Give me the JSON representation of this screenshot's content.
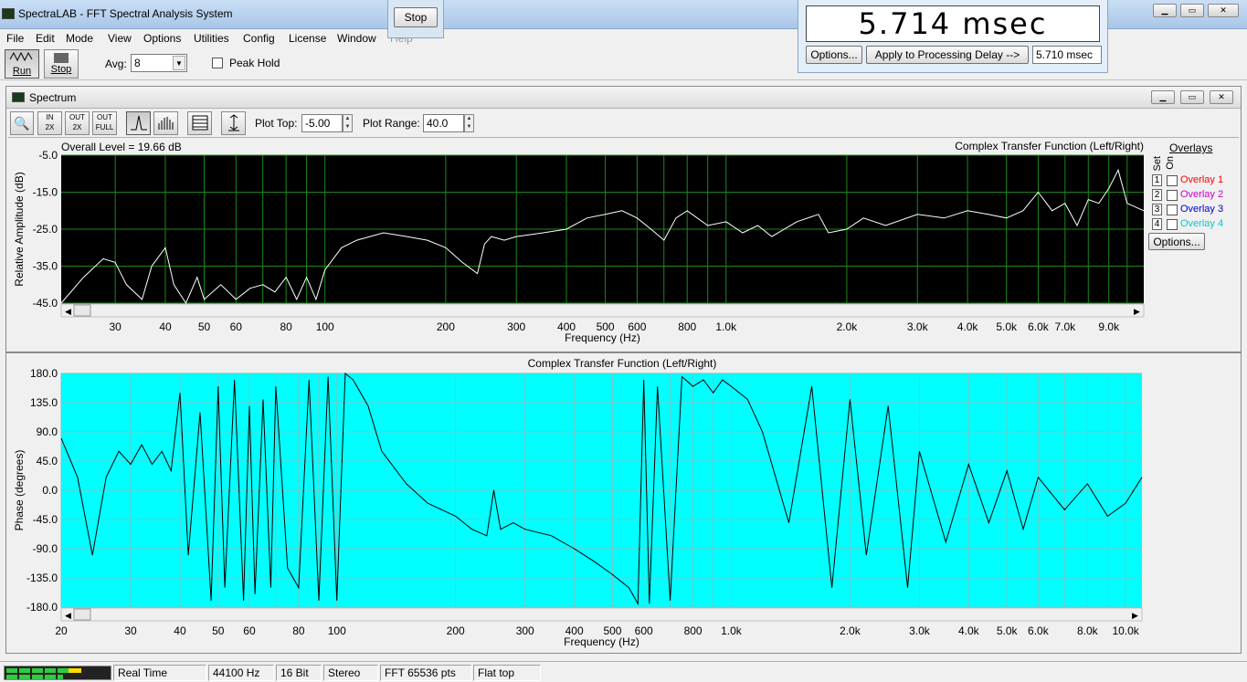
{
  "window": {
    "title": "SpectraLAB - FFT Spectral Analysis System"
  },
  "menu": [
    "File",
    "Edit",
    "Mode",
    "View",
    "Options",
    "Utilities",
    "Config",
    "License",
    "Window",
    "Help"
  ],
  "toolbar": {
    "run_label": "Run",
    "stop_label": "Stop",
    "avg_label": "Avg:",
    "avg_value": "8",
    "peak_hold_label": "Peak Hold"
  },
  "floating_stop": {
    "label": "Stop"
  },
  "delay_panel": {
    "value": "5.714  msec",
    "options_label": "Options...",
    "apply_label": "Apply to Processing Delay -->",
    "delay_field": "5.710 msec"
  },
  "spectrum": {
    "title": "Spectrum",
    "plot_top_label": "Plot Top:",
    "plot_top_value": "-5.00",
    "plot_range_label": "Plot Range:",
    "plot_range_value": "40.0",
    "overall_level": "Overall Level = 19.66 dB",
    "chart_title": "Complex Transfer Function (Left/Right)",
    "ylabel": "Relative Amplitude (dB)",
    "xlabel": "Frequency (Hz)",
    "y_ticks": [
      "-5.0",
      "-15.0",
      "-25.0",
      "-35.0",
      "-45.0"
    ],
    "x_ticks": [
      "30",
      "40",
      "50",
      "60",
      "80",
      "100",
      "200",
      "300",
      "400",
      "500",
      "600",
      "800",
      "1.0k",
      "2.0k",
      "3.0k",
      "4.0k",
      "5.0k",
      "6.0k",
      "7.0k",
      "9.0k"
    ],
    "overlays_label": "Overlays",
    "set_label": "Set",
    "on_label": "On",
    "overlays": [
      {
        "num": "1",
        "label": "Overlay 1",
        "color": "#ff0000"
      },
      {
        "num": "2",
        "label": "Overlay 2",
        "color": "#cc00cc"
      },
      {
        "num": "3",
        "label": "Overlay 3",
        "color": "#0000cc"
      },
      {
        "num": "4",
        "label": "Overlay 4",
        "color": "#00cccc"
      }
    ],
    "options_label": "Options..."
  },
  "phase": {
    "chart_title": "Complex Transfer Function (Left/Right)",
    "ylabel": "Phase (degrees)",
    "xlabel": "Frequency (Hz)",
    "y_ticks": [
      "180.0",
      "135.0",
      "90.0",
      "45.0",
      "0.0",
      "-45.0",
      "-90.0",
      "-135.0",
      "-180.0"
    ],
    "x_ticks": [
      "20",
      "30",
      "40",
      "50",
      "60",
      "80",
      "100",
      "200",
      "300",
      "400",
      "500",
      "600",
      "800",
      "1.0k",
      "2.0k",
      "3.0k",
      "4.0k",
      "5.0k",
      "6.0k",
      "8.0k",
      "10.0k"
    ]
  },
  "status": {
    "mode": "Real Time",
    "rate": "44100 Hz",
    "bits": "16 Bit",
    "channels": "Stereo",
    "fft": "FFT 65536 pts",
    "window": "Flat top"
  },
  "chart_data": [
    {
      "type": "line",
      "title": "Complex Transfer Function (Left/Right)",
      "xlabel": "Frequency (Hz)",
      "ylabel": "Relative Amplitude (dB)",
      "xscale": "log",
      "xlim": [
        22,
        11000
      ],
      "ylim": [
        -45,
        -5
      ],
      "grid": true,
      "series": [
        {
          "x": [
            22,
            25,
            28,
            30,
            32,
            35,
            37,
            40,
            42,
            45,
            48,
            50,
            55,
            60,
            65,
            70,
            75,
            80,
            85,
            90,
            95,
            100,
            110,
            120,
            140,
            160,
            180,
            200,
            220,
            240,
            250,
            260,
            280,
            300,
            350,
            400,
            450,
            500,
            550,
            600,
            650,
            700,
            750,
            800,
            900,
            1000,
            1100,
            1200,
            1300,
            1500,
            1700,
            1800,
            2000,
            2200,
            2500,
            3000,
            3500,
            4000,
            4500,
            5000,
            5500,
            6000,
            6500,
            7000,
            7500,
            8000,
            8500,
            9000,
            9500,
            10000,
            11000
          ],
          "y": [
            -45,
            -38,
            -33,
            -34,
            -40,
            -44,
            -35,
            -30,
            -40,
            -45,
            -38,
            -44,
            -40,
            -44,
            -41,
            -40,
            -42,
            -38,
            -44,
            -38,
            -44,
            -36,
            -30,
            -28,
            -26,
            -27,
            -28,
            -30,
            -34,
            -37,
            -29,
            -27,
            -28,
            -27,
            -26,
            -25,
            -22,
            -21,
            -20,
            -22,
            -25,
            -28,
            -22,
            -20,
            -24,
            -23,
            -26,
            -24,
            -27,
            -23,
            -21,
            -26,
            -25,
            -22,
            -24,
            -21,
            -22,
            -20,
            -21,
            -22,
            -20,
            -15,
            -20,
            -18,
            -24,
            -17,
            -18,
            -14,
            -9,
            -18,
            -20
          ]
        }
      ]
    },
    {
      "type": "line",
      "title": "Complex Transfer Function (Left/Right)",
      "xlabel": "Frequency (Hz)",
      "ylabel": "Phase (degrees)",
      "xscale": "log",
      "xlim": [
        20,
        11000
      ],
      "ylim": [
        -180,
        180
      ],
      "grid": true,
      "series": [
        {
          "x": [
            20,
            22,
            24,
            26,
            28,
            30,
            32,
            34,
            36,
            38,
            40,
            42,
            45,
            48,
            50,
            52,
            55,
            58,
            60,
            62,
            65,
            68,
            70,
            75,
            80,
            85,
            90,
            95,
            100,
            105,
            110,
            120,
            130,
            150,
            170,
            200,
            220,
            240,
            250,
            260,
            280,
            300,
            350,
            400,
            450,
            500,
            550,
            580,
            600,
            620,
            650,
            700,
            750,
            800,
            850,
            900,
            950,
            1000,
            1100,
            1200,
            1400,
            1600,
            1800,
            2000,
            2200,
            2500,
            2800,
            3000,
            3500,
            4000,
            4500,
            5000,
            5500,
            6000,
            7000,
            8000,
            9000,
            10000,
            11000
          ],
          "y": [
            80,
            20,
            -100,
            20,
            60,
            40,
            70,
            40,
            60,
            30,
            150,
            -100,
            120,
            -170,
            160,
            -150,
            170,
            -170,
            130,
            -160,
            140,
            -150,
            160,
            -120,
            -150,
            170,
            -170,
            175,
            -170,
            180,
            170,
            130,
            60,
            10,
            -20,
            -40,
            -60,
            -70,
            0,
            -60,
            -50,
            -60,
            -70,
            -90,
            -110,
            -130,
            -150,
            -175,
            170,
            -175,
            160,
            -170,
            175,
            160,
            170,
            150,
            170,
            160,
            140,
            90,
            -50,
            160,
            -150,
            140,
            -100,
            130,
            -150,
            60,
            -80,
            40,
            -50,
            30,
            -60,
            20,
            -30,
            10,
            -40,
            -20,
            20
          ]
        }
      ]
    }
  ]
}
